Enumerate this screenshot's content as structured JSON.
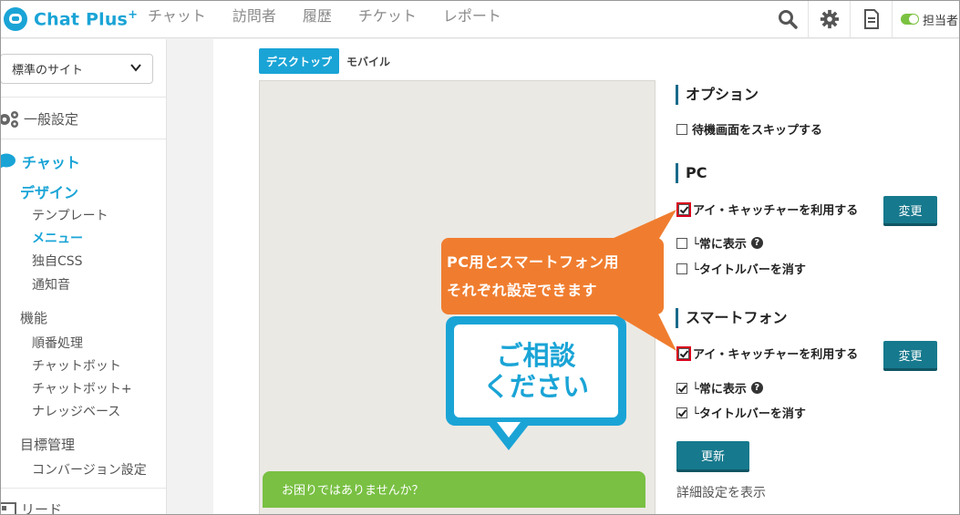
{
  "app": {
    "logo_text": "Chat Plus",
    "logo_plus": "+"
  },
  "nav": {
    "items": [
      "チャット",
      "訪問者",
      "履歴",
      "チケット",
      "レポート"
    ]
  },
  "header": {
    "status_label": "担当者"
  },
  "sidebar": {
    "site_select": "標準のサイト",
    "general_settings": "一般設定",
    "chat": "チャット",
    "design": "デザイン",
    "design_items": [
      "テンプレート",
      "メニュー",
      "独自CSS",
      "通知音"
    ],
    "features": "機能",
    "feature_items": [
      "順番処理",
      "チャットボット",
      "チャットボット+",
      "ナレッジベース"
    ],
    "goals": "目標管理",
    "goal_items": [
      "コンバージョン設定"
    ],
    "leads": "リード"
  },
  "tabs": {
    "desktop": "デスクトップ",
    "mobile": "モバイル"
  },
  "preview": {
    "bubble_line1": "ご相談",
    "bubble_line2": "ください",
    "chat_bar": "お困りではありませんか？"
  },
  "options": {
    "title": "オプション",
    "skip_waiting": "待機画面をスキップする",
    "pc_title": "PC",
    "use_eyecatcher": "アイ・キャッチャーを利用する",
    "always_show": "└常に表示",
    "hide_titlebar": "└タイトルバーを消す",
    "sp_title": "スマートフォン",
    "change_label": "変更",
    "update_label": "更新",
    "details_link": "詳細設定を表示",
    "help_glyph": "?"
  },
  "callout": {
    "line1": "PC用とスマートフォン用",
    "line2": "それぞれ設定できます",
    "color": "#f07d2f"
  },
  "colors": {
    "accent": "#1aa4d6",
    "button": "#16798d",
    "chat_bar": "#79c043",
    "highlight": "#d9001b"
  }
}
